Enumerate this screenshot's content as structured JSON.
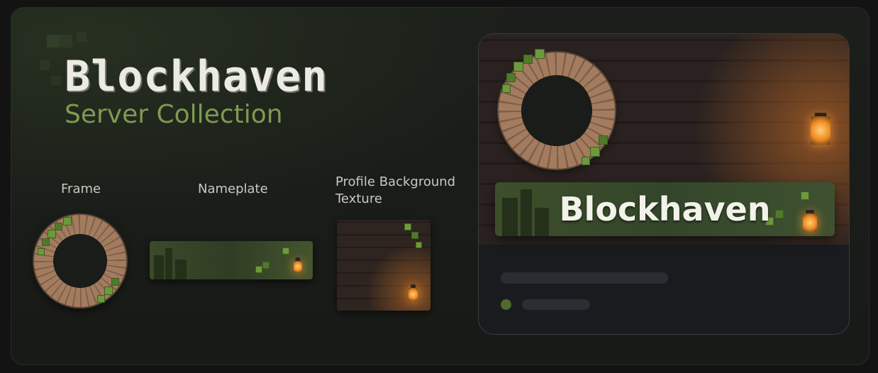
{
  "header": {
    "title": "Blockhaven",
    "subtitle": "Server Collection"
  },
  "items": {
    "frame_label": "Frame",
    "nameplate_label": "Nameplate",
    "texture_label": "Profile Background Texture"
  },
  "preview": {
    "display_name": "Blockhaven"
  },
  "colors": {
    "accent": "#7e9a52",
    "title": "#ecebe3",
    "background": "#181a17",
    "panel": "#191b1f",
    "leaf": "#6d9a3a",
    "wood": "#8b6a52",
    "lantern_glow": "#f08a22"
  },
  "icons": [
    "vine-frame-icon",
    "lantern-icon"
  ]
}
